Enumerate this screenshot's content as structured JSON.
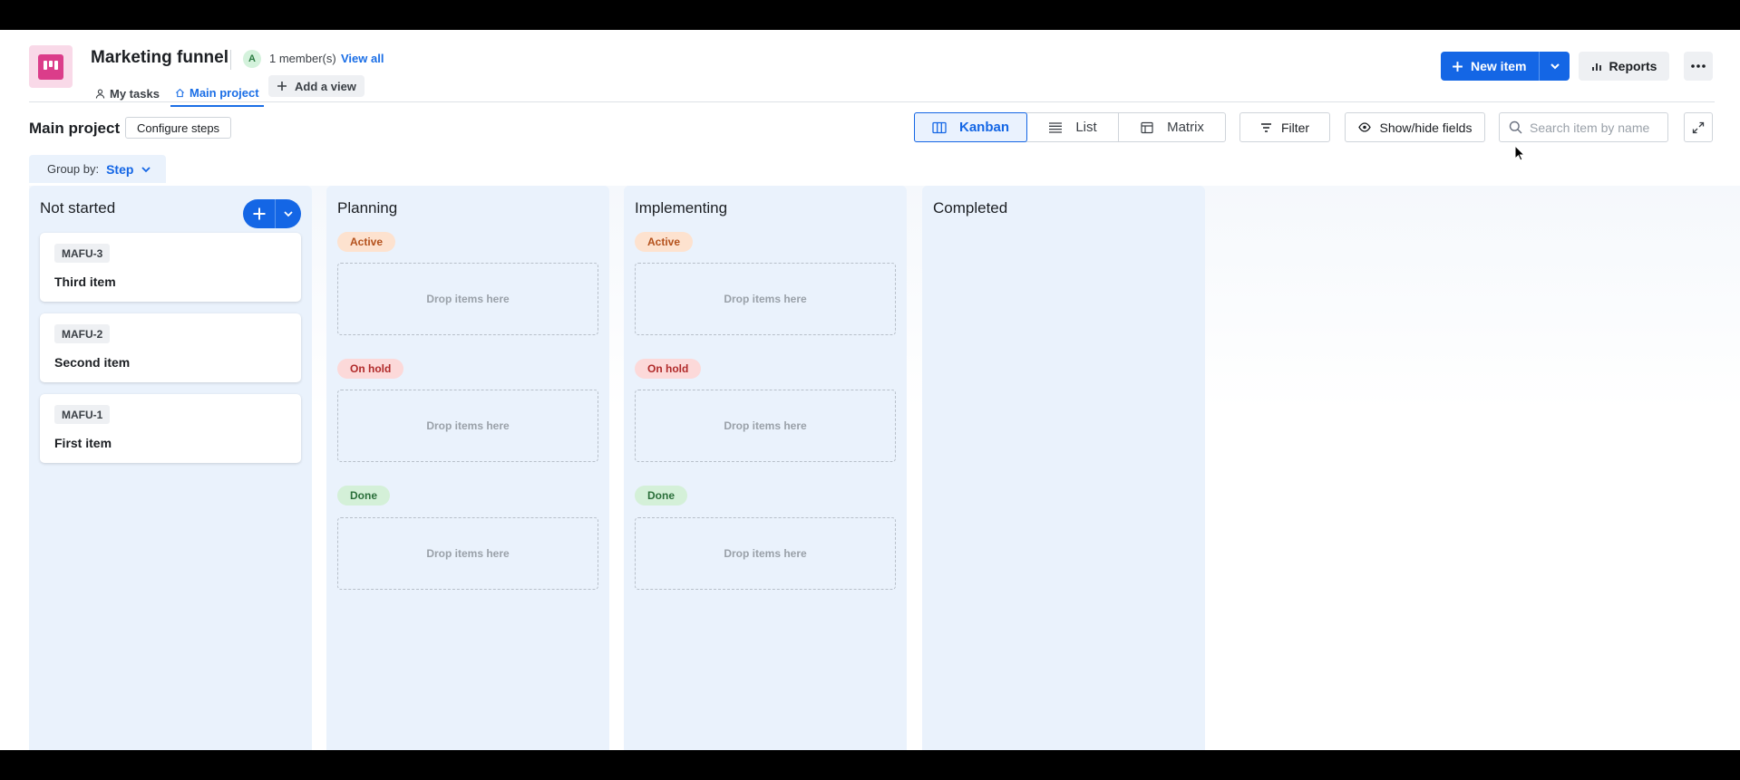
{
  "header": {
    "title": "Marketing funnel",
    "avatar_initial": "A",
    "members": "1 member(s)",
    "view_all": "View all",
    "tabs": [
      {
        "label": "My tasks",
        "icon": "person-icon"
      },
      {
        "label": "Main project",
        "icon": "home-icon",
        "active": true
      }
    ],
    "add_view": "Add a view",
    "new_item": "New item",
    "reports": "Reports"
  },
  "toolbar": {
    "project_title": "Main project",
    "configure_steps": "Configure steps",
    "views": [
      {
        "label": "Kanban",
        "icon": "kanban-icon",
        "active": true
      },
      {
        "label": "List",
        "icon": "list-icon"
      },
      {
        "label": "Matrix",
        "icon": "matrix-icon"
      }
    ],
    "filter": "Filter",
    "show_hide": "Show/hide fields",
    "search_placeholder": "Search item by name",
    "group_by_label": "Group by:",
    "group_by_value": "Step"
  },
  "board": {
    "columns": [
      {
        "title": "Not started",
        "cards": [
          {
            "key": "MAFU-3",
            "name": "Third item"
          },
          {
            "key": "MAFU-2",
            "name": "Second item"
          },
          {
            "key": "MAFU-1",
            "name": "First item"
          }
        ]
      },
      {
        "title": "Planning",
        "statuses": [
          {
            "label": "Active",
            "drop": "Drop items here"
          },
          {
            "label": "On hold",
            "drop": "Drop items here"
          },
          {
            "label": "Done",
            "drop": "Drop items here"
          }
        ]
      },
      {
        "title": "Implementing",
        "statuses": [
          {
            "label": "Active",
            "drop": "Drop items here"
          },
          {
            "label": "On hold",
            "drop": "Drop items here"
          },
          {
            "label": "Done",
            "drop": "Drop items here"
          }
        ]
      },
      {
        "title": "Completed"
      }
    ]
  },
  "colors": {
    "primary": "#1466e5",
    "logo": "#db3d8a",
    "column_bg": "#eaf2fc"
  }
}
